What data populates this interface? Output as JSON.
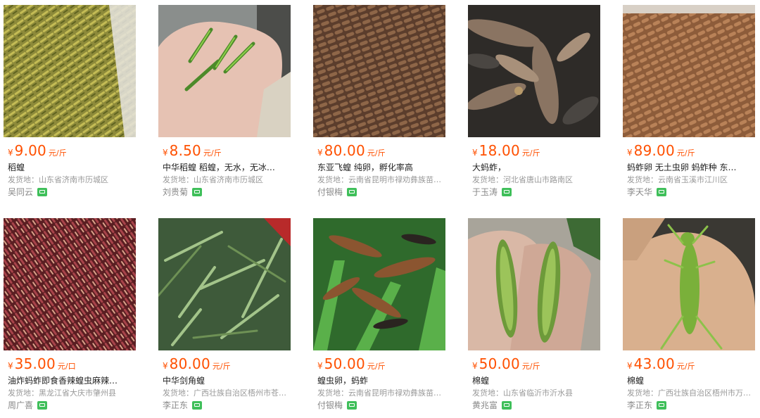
{
  "colors": {
    "price": "#ff5000",
    "chat_icon": "#3fbf5a"
  },
  "products": [
    {
      "currency": "¥",
      "price": "9.00",
      "unit": "元/斤",
      "title": "稻蝗",
      "origin": "发货地：山东省济南市历城区",
      "seller": "吴同云",
      "icon": "wangwang-chat-icon"
    },
    {
      "currency": "¥",
      "price": "8.50",
      "unit": "元/斤",
      "title": "中华稻蝗 稻蝗，无水，无冰…",
      "origin": "发货地：山东省济南市历城区",
      "seller": "刘贵菊",
      "icon": "wangwang-chat-icon"
    },
    {
      "currency": "¥",
      "price": "80.00",
      "unit": "元/斤",
      "title": "东亚飞蝗 纯卵，孵化率高",
      "origin": "发货地：云南省昆明市禄劝彝族苗…",
      "seller": "付银梅",
      "icon": "wangwang-chat-icon"
    },
    {
      "currency": "¥",
      "price": "18.00",
      "unit": "元/斤",
      "title": "大蚂蚱，",
      "origin": "发货地：河北省唐山市路南区",
      "seller": "于玉涛",
      "icon": "wangwang-chat-icon"
    },
    {
      "currency": "¥",
      "price": "89.00",
      "unit": "元/斤",
      "title": "蚂蚱卵 无土虫卵 蚂蚱种 东…",
      "origin": "发货地：云南省玉溪市江川区",
      "seller": "李天华",
      "icon": "wangwang-chat-icon"
    },
    {
      "currency": "¥",
      "price": "35.00",
      "unit": "元/口",
      "title": "油炸蚂蚱即食香辣蝗虫麻辣…",
      "origin": "发货地：黑龙江省大庆市肇州县",
      "seller": "周广喜",
      "icon": "wangwang-chat-icon"
    },
    {
      "currency": "¥",
      "price": "80.00",
      "unit": "元/斤",
      "title": "中华剑角蝗",
      "origin": "发货地：广西壮族自治区梧州市苍…",
      "seller": "李正东",
      "icon": "wangwang-chat-icon"
    },
    {
      "currency": "¥",
      "price": "50.00",
      "unit": "元/斤",
      "title": "蝗虫卵，蚂蚱",
      "origin": "发货地：云南省昆明市禄劝彝族苗…",
      "seller": "付银梅",
      "icon": "wangwang-chat-icon"
    },
    {
      "currency": "¥",
      "price": "50.00",
      "unit": "元/斤",
      "title": "棉蝗",
      "origin": "发货地：山东省临沂市沂水县",
      "seller": "黄兆富",
      "icon": "wangwang-chat-icon"
    },
    {
      "currency": "¥",
      "price": "43.00",
      "unit": "元/斤",
      "title": "棉蝗",
      "origin": "发货地：广西壮族自治区梧州市万…",
      "seller": "李正东",
      "icon": "wangwang-chat-icon"
    }
  ]
}
